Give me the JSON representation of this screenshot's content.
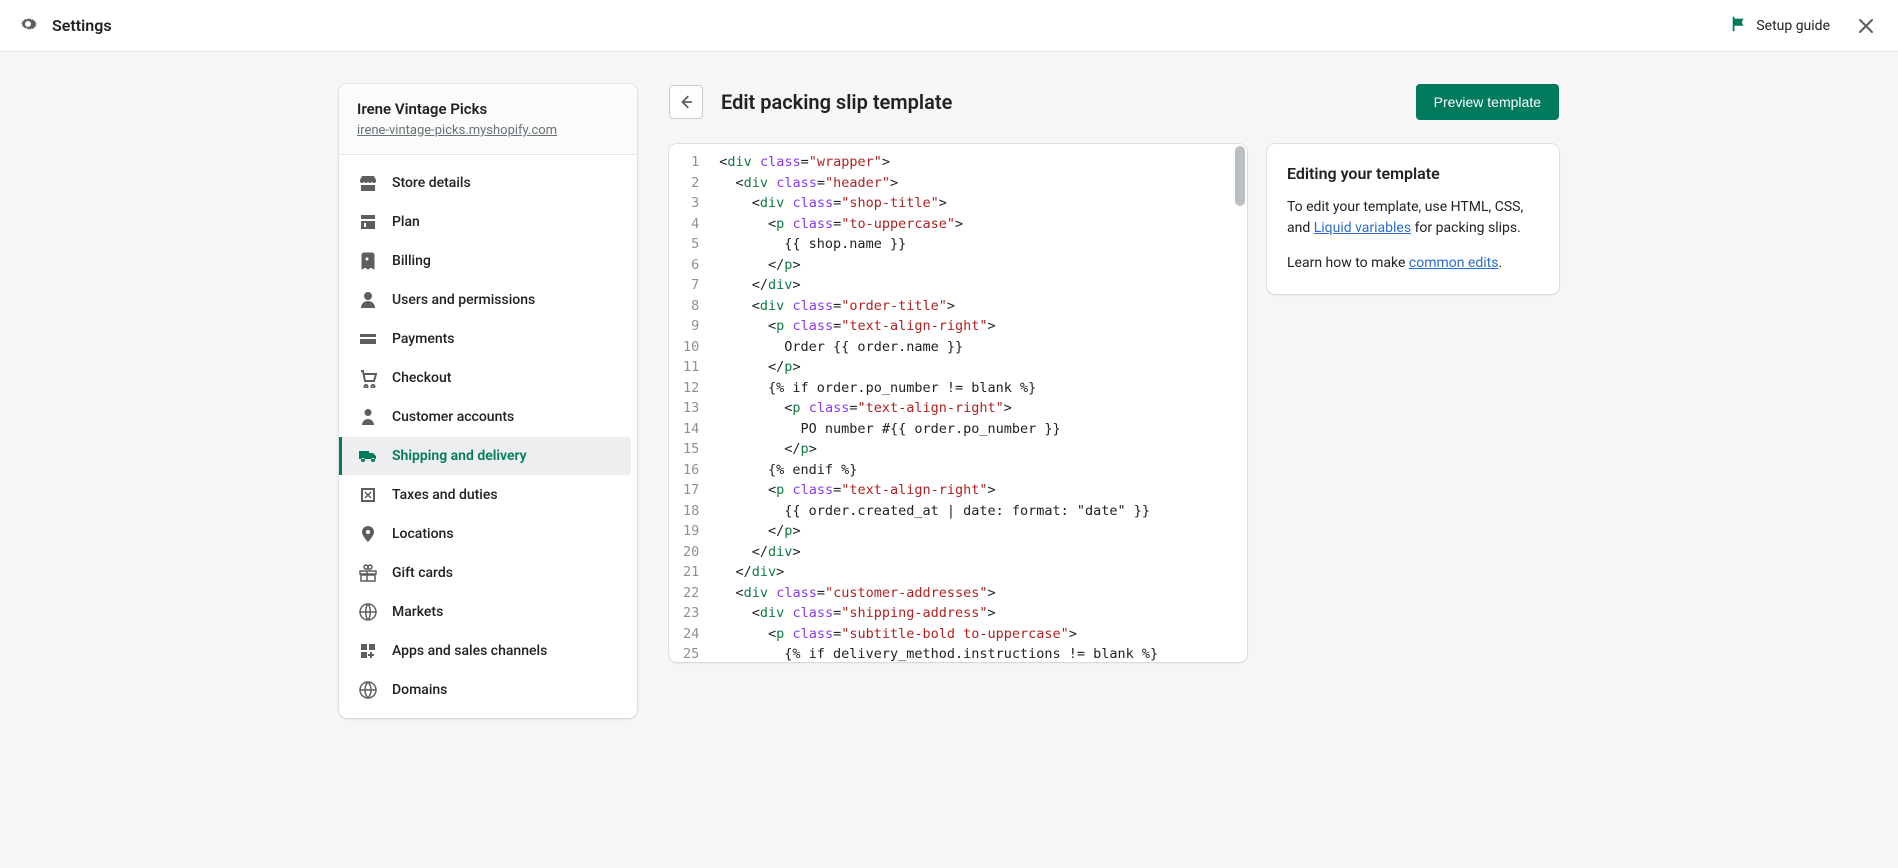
{
  "topbar": {
    "title": "Settings",
    "setup_guide": "Setup guide"
  },
  "store": {
    "name": "Irene Vintage Picks",
    "url": "irene-vintage-picks.myshopify.com"
  },
  "nav": [
    {
      "label": "Store details",
      "icon": "store"
    },
    {
      "label": "Plan",
      "icon": "plan"
    },
    {
      "label": "Billing",
      "icon": "billing"
    },
    {
      "label": "Users and permissions",
      "icon": "users"
    },
    {
      "label": "Payments",
      "icon": "payments"
    },
    {
      "label": "Checkout",
      "icon": "checkout"
    },
    {
      "label": "Customer accounts",
      "icon": "customer"
    },
    {
      "label": "Shipping and delivery",
      "icon": "shipping",
      "active": true
    },
    {
      "label": "Taxes and duties",
      "icon": "taxes"
    },
    {
      "label": "Locations",
      "icon": "locations"
    },
    {
      "label": "Gift cards",
      "icon": "gift"
    },
    {
      "label": "Markets",
      "icon": "markets"
    },
    {
      "label": "Apps and sales channels",
      "icon": "apps"
    },
    {
      "label": "Domains",
      "icon": "domains"
    }
  ],
  "page": {
    "title": "Edit packing slip template",
    "preview_btn": "Preview template"
  },
  "help": {
    "title": "Editing your template",
    "text1_a": "To edit your template, use HTML, CSS, and ",
    "text1_link": "Liquid variables",
    "text1_b": " for packing slips.",
    "text2_a": "Learn how to make ",
    "text2_link": "common edits",
    "text2_b": "."
  },
  "code": {
    "lines": [
      [
        [
          "<",
          "p"
        ],
        [
          "div",
          "t"
        ],
        [
          " ",
          "p"
        ],
        [
          "class",
          "a"
        ],
        [
          "=",
          "p"
        ],
        [
          "\"wrapper\"",
          "s"
        ],
        [
          ">",
          "p"
        ]
      ],
      [
        [
          "  <",
          "p"
        ],
        [
          "div",
          "t"
        ],
        [
          " ",
          "p"
        ],
        [
          "class",
          "a"
        ],
        [
          "=",
          "p"
        ],
        [
          "\"header\"",
          "s"
        ],
        [
          ">",
          "p"
        ]
      ],
      [
        [
          "    <",
          "p"
        ],
        [
          "div",
          "t"
        ],
        [
          " ",
          "p"
        ],
        [
          "class",
          "a"
        ],
        [
          "=",
          "p"
        ],
        [
          "\"shop-title\"",
          "s"
        ],
        [
          ">",
          "p"
        ]
      ],
      [
        [
          "      <",
          "p"
        ],
        [
          "p",
          "t"
        ],
        [
          " ",
          "p"
        ],
        [
          "class",
          "a"
        ],
        [
          "=",
          "p"
        ],
        [
          "\"to-uppercase\"",
          "s"
        ],
        [
          ">",
          "p"
        ]
      ],
      [
        [
          "        {{ shop.name }}",
          "x"
        ]
      ],
      [
        [
          "      </",
          "p"
        ],
        [
          "p",
          "t"
        ],
        [
          ">",
          "p"
        ]
      ],
      [
        [
          "    </",
          "p"
        ],
        [
          "div",
          "t"
        ],
        [
          ">",
          "p"
        ]
      ],
      [
        [
          "    <",
          "p"
        ],
        [
          "div",
          "t"
        ],
        [
          " ",
          "p"
        ],
        [
          "class",
          "a"
        ],
        [
          "=",
          "p"
        ],
        [
          "\"order-title\"",
          "s"
        ],
        [
          ">",
          "p"
        ]
      ],
      [
        [
          "      <",
          "p"
        ],
        [
          "p",
          "t"
        ],
        [
          " ",
          "p"
        ],
        [
          "class",
          "a"
        ],
        [
          "=",
          "p"
        ],
        [
          "\"text-align-right\"",
          "s"
        ],
        [
          ">",
          "p"
        ]
      ],
      [
        [
          "        Order {{ order.name }}",
          "x"
        ]
      ],
      [
        [
          "      </",
          "p"
        ],
        [
          "p",
          "t"
        ],
        [
          ">",
          "p"
        ]
      ],
      [
        [
          "      {% if order.po_number != blank %}",
          "x"
        ]
      ],
      [
        [
          "        <",
          "p"
        ],
        [
          "p",
          "t"
        ],
        [
          " ",
          "p"
        ],
        [
          "class",
          "a"
        ],
        [
          "=",
          "p"
        ],
        [
          "\"text-align-right\"",
          "s"
        ],
        [
          ">",
          "p"
        ]
      ],
      [
        [
          "          PO number #{{ order.po_number }}",
          "x"
        ]
      ],
      [
        [
          "        </",
          "p"
        ],
        [
          "p",
          "t"
        ],
        [
          ">",
          "p"
        ]
      ],
      [
        [
          "      {% endif %}",
          "x"
        ]
      ],
      [
        [
          "      <",
          "p"
        ],
        [
          "p",
          "t"
        ],
        [
          " ",
          "p"
        ],
        [
          "class",
          "a"
        ],
        [
          "=",
          "p"
        ],
        [
          "\"text-align-right\"",
          "s"
        ],
        [
          ">",
          "p"
        ]
      ],
      [
        [
          "        {{ order.created_at | date: format: \"date\" }}",
          "x"
        ]
      ],
      [
        [
          "      </",
          "p"
        ],
        [
          "p",
          "t"
        ],
        [
          ">",
          "p"
        ]
      ],
      [
        [
          "    </",
          "p"
        ],
        [
          "div",
          "t"
        ],
        [
          ">",
          "p"
        ]
      ],
      [
        [
          "  </",
          "p"
        ],
        [
          "div",
          "t"
        ],
        [
          ">",
          "p"
        ]
      ],
      [
        [
          "  <",
          "p"
        ],
        [
          "div",
          "t"
        ],
        [
          " ",
          "p"
        ],
        [
          "class",
          "a"
        ],
        [
          "=",
          "p"
        ],
        [
          "\"customer-addresses\"",
          "s"
        ],
        [
          ">",
          "p"
        ]
      ],
      [
        [
          "    <",
          "p"
        ],
        [
          "div",
          "t"
        ],
        [
          " ",
          "p"
        ],
        [
          "class",
          "a"
        ],
        [
          "=",
          "p"
        ],
        [
          "\"shipping-address\"",
          "s"
        ],
        [
          ">",
          "p"
        ]
      ],
      [
        [
          "      <",
          "p"
        ],
        [
          "p",
          "t"
        ],
        [
          " ",
          "p"
        ],
        [
          "class",
          "a"
        ],
        [
          "=",
          "p"
        ],
        [
          "\"subtitle-bold to-uppercase\"",
          "s"
        ],
        [
          ">",
          "p"
        ]
      ],
      [
        [
          "        {% if delivery_method.instructions != blank %}",
          "x"
        ]
      ]
    ]
  }
}
